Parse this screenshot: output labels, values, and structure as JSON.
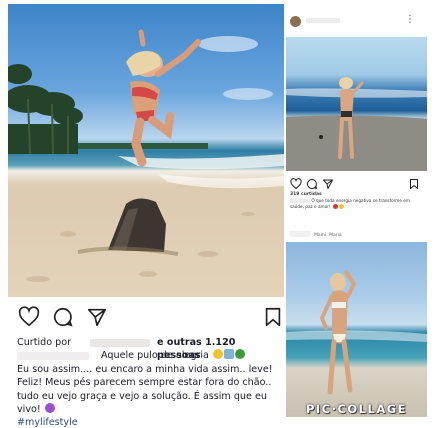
{
  "left_post": {
    "liked_by_prefix": "Curtido por",
    "liked_by_suffix": "e outras 1.120 pessoas",
    "caption_line1": "Aquele pulo de alegria",
    "caption_body": "Eu sou assim.... eu encaro a minha vida assim.. leve! Feliz! Meus pés parecem sempre estar fora do chão.. tudo eu vejo graça e vejo a solução. É assim que eu vivo!",
    "hashtag": "#mylifestyle",
    "icons": [
      "heart-icon",
      "comment-icon",
      "share-icon",
      "bookmark-icon"
    ]
  },
  "right_top_post": {
    "likes": "319 curtidas",
    "caption": "O que toda energia negativa se transforme em saúde, paz e amor!",
    "icons": [
      "heart-icon",
      "comment-icon",
      "share-icon",
      "bookmark-icon",
      "more-icon"
    ]
  },
  "right_bottom_post": {
    "username": "Mami, Maria"
  },
  "watermark": "PIC·COLLAGE",
  "colors": {
    "hashtag": "#2c4b85",
    "text": "#1c1c2a"
  }
}
